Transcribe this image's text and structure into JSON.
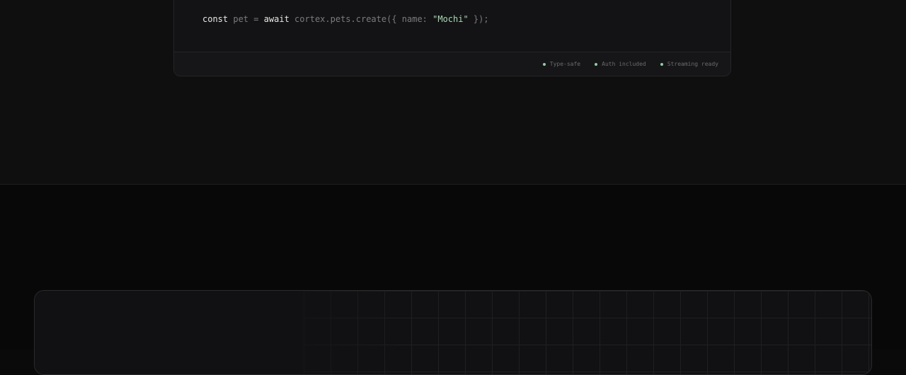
{
  "code_sample": {
    "kw_const": "const",
    "var_name": " pet = ",
    "kw_await": "await",
    "call": " cortex.pets.create({ name: ",
    "string_value": "\"Mochi\"",
    "closing": " });"
  },
  "features": [
    {
      "label": "Type-safe"
    },
    {
      "label": "Auth included"
    },
    {
      "label": "Streaming ready"
    }
  ],
  "colors": {
    "accent_green": "#8fcf9f",
    "string_green": "#a9dbb5",
    "background": "#0a0a0a"
  }
}
